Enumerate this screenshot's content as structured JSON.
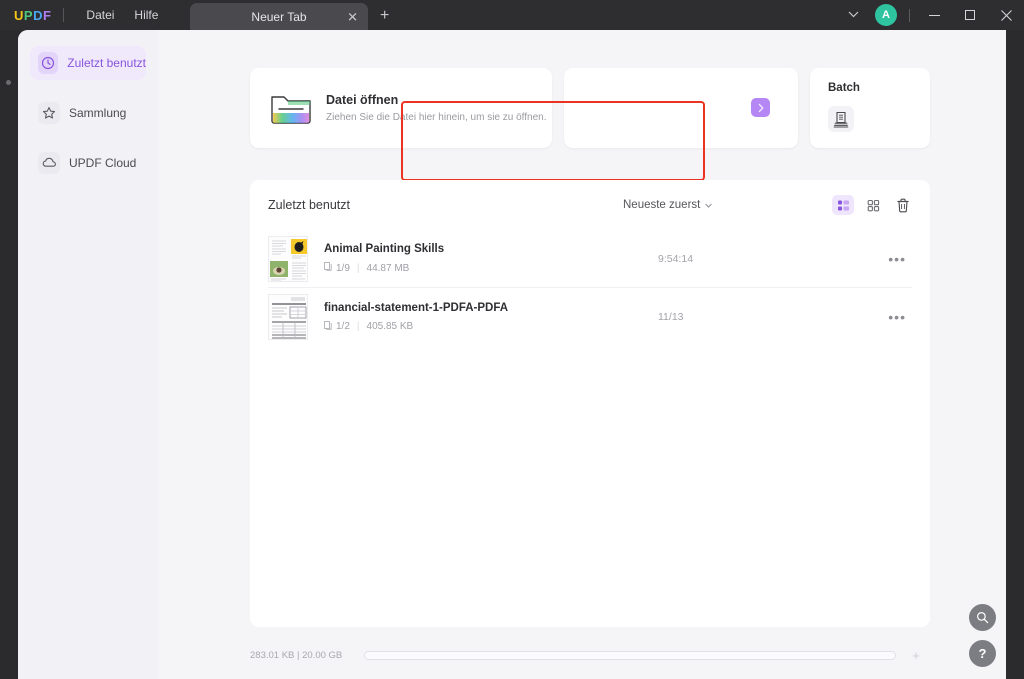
{
  "titlebar": {
    "logo": {
      "l1": "U",
      "l2": "P",
      "l3": "D",
      "l4": "F"
    },
    "menu": [
      {
        "label": "Datei",
        "name": "menu-datei"
      },
      {
        "label": "Hilfe",
        "name": "menu-hilfe"
      }
    ],
    "tab": {
      "label": "Neuer Tab",
      "close": "✕"
    },
    "new_tab": "+",
    "chevron": "⌄",
    "avatar_initial": "A",
    "minimize": "─",
    "maximize": "□",
    "close": "✕"
  },
  "sidebar": {
    "items": [
      {
        "label": "Zuletzt benutzt",
        "icon": "clock-icon",
        "active": true
      },
      {
        "label": "Sammlung",
        "icon": "star-icon",
        "active": false
      },
      {
        "label": "UPDF Cloud",
        "icon": "cloud-icon",
        "active": false
      }
    ]
  },
  "cards": {
    "open": {
      "title": "Datei öffnen",
      "subtitle": "Ziehen Sie die Datei hier hinein, um sie zu öffnen.",
      "icon": "folder-icon",
      "highlight_color": "#ea3323"
    },
    "middle": {
      "button_icon": "chevron-right-icon",
      "button_color": "#b487f5"
    },
    "batch": {
      "title": "Batch",
      "icon": "batch-documents-icon"
    }
  },
  "recent": {
    "title": "Zuletzt benutzt",
    "sort_label": "Neueste zuerst",
    "sort_caret": "▼",
    "view_list_icon": "list-view-icon",
    "view_grid_icon": "grid-view-icon",
    "delete_icon": "trash-icon",
    "accent": "#8855dd",
    "files": [
      {
        "name": "Animal Painting Skills",
        "pages": "1/9",
        "size": "44.87 MB",
        "time": "9:54:14",
        "more": "•••"
      },
      {
        "name": "financial-statement-1-PDFA-PDFA",
        "pages": "1/2",
        "size": "405.85 KB",
        "time": "11/13",
        "more": "•••"
      }
    ]
  },
  "status": {
    "usage": "283.01 KB | 20.00 GB",
    "progress_percent": 0,
    "plus": "+"
  },
  "fabs": {
    "search_icon": "search-icon",
    "help_label": "?"
  }
}
